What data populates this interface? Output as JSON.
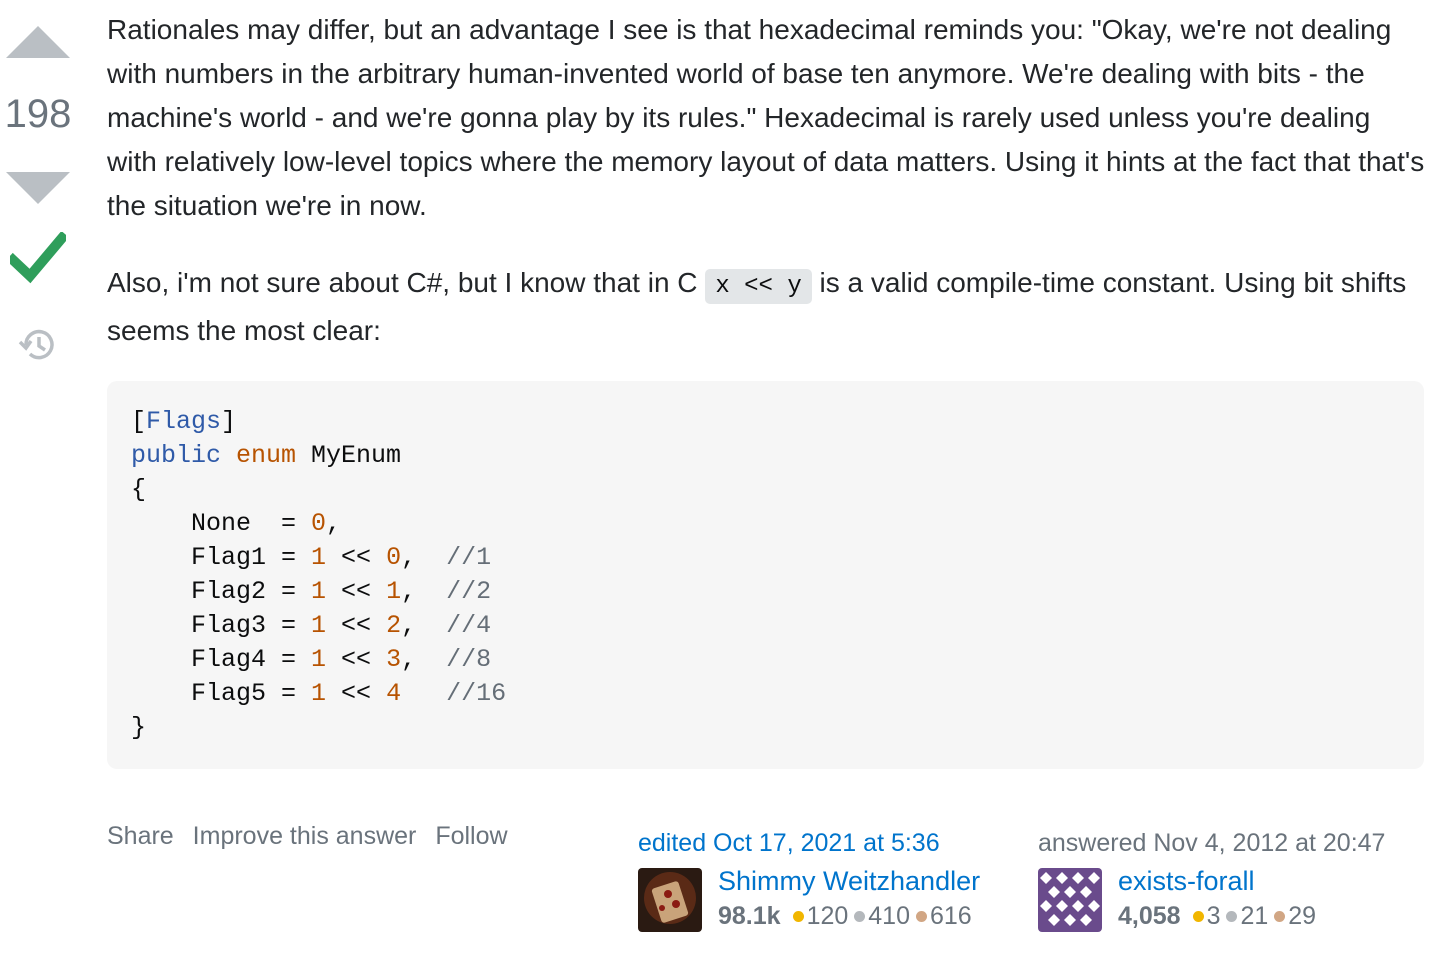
{
  "vote": {
    "score": "198",
    "upvote_icon": "triangle-up-icon",
    "downvote_icon": "triangle-down-icon",
    "accepted_icon": "checkmark-icon",
    "history_icon": "history-clock-icon",
    "colors": {
      "arrow": "#babfc4",
      "accepted": "#2f9e5b"
    }
  },
  "post": {
    "paragraph1": "Rationales may differ, but an advantage I see is that hexadecimal reminds you: \"Okay, we're not dealing with numbers in the arbitrary human-invented world of base ten anymore. We're dealing with bits - the machine's world - and we're gonna play by its rules.\" Hexadecimal is rarely used unless you're dealing with relatively low-level topics where the memory layout of data matters. Using it hints at the fact that that's the situation we're in now.",
    "paragraph2_before": "Also, i'm not sure about C#, but I know that in C ",
    "paragraph2_code": "x << y",
    "paragraph2_after": " is a valid compile-time constant. Using bit shifts seems the most clear:"
  },
  "code": {
    "lines": [
      [
        {
          "t": "["
        },
        {
          "t": "Flags",
          "c": "kw"
        },
        {
          "t": "]"
        }
      ],
      [
        {
          "t": "public",
          "c": "kw"
        },
        {
          "t": " "
        },
        {
          "t": "enum",
          "c": "kw2"
        },
        {
          "t": " MyEnum"
        }
      ],
      [
        {
          "t": "{"
        }
      ],
      [
        {
          "t": "    None  = "
        },
        {
          "t": "0",
          "c": "num"
        },
        {
          "t": ","
        }
      ],
      [
        {
          "t": "    Flag1 = "
        },
        {
          "t": "1",
          "c": "num"
        },
        {
          "t": " << "
        },
        {
          "t": "0",
          "c": "num"
        },
        {
          "t": ",  "
        },
        {
          "t": "//1",
          "c": "cm"
        }
      ],
      [
        {
          "t": "    Flag2 = "
        },
        {
          "t": "1",
          "c": "num"
        },
        {
          "t": " << "
        },
        {
          "t": "1",
          "c": "num"
        },
        {
          "t": ",  "
        },
        {
          "t": "//2",
          "c": "cm"
        }
      ],
      [
        {
          "t": "    Flag3 = "
        },
        {
          "t": "1",
          "c": "num"
        },
        {
          "t": " << "
        },
        {
          "t": "2",
          "c": "num"
        },
        {
          "t": ",  "
        },
        {
          "t": "//4",
          "c": "cm"
        }
      ],
      [
        {
          "t": "    Flag4 = "
        },
        {
          "t": "1",
          "c": "num"
        },
        {
          "t": " << "
        },
        {
          "t": "3",
          "c": "num"
        },
        {
          "t": ",  "
        },
        {
          "t": "//8",
          "c": "cm"
        }
      ],
      [
        {
          "t": "    Flag5 = "
        },
        {
          "t": "1",
          "c": "num"
        },
        {
          "t": " << "
        },
        {
          "t": "4",
          "c": "num"
        },
        {
          "t": "   "
        },
        {
          "t": "//16",
          "c": "cm"
        }
      ],
      [
        {
          "t": "}"
        }
      ]
    ]
  },
  "menu": {
    "share": "Share",
    "improve": "Improve this answer",
    "follow": "Follow"
  },
  "editor": {
    "action": "edited Oct 17, 2021 at 5:36",
    "name": "Shimmy Weitzhandler",
    "reputation": "98.1k",
    "gold": "120",
    "silver": "410",
    "bronze": "616",
    "avatar_icon": "user-avatar-icon"
  },
  "author": {
    "action": "answered Nov 4, 2012 at 20:47",
    "name": "exists-forall",
    "reputation": "4,058",
    "gold": "3",
    "silver": "21",
    "bronze": "29",
    "avatar_icon": "identicon-avatar-icon"
  }
}
